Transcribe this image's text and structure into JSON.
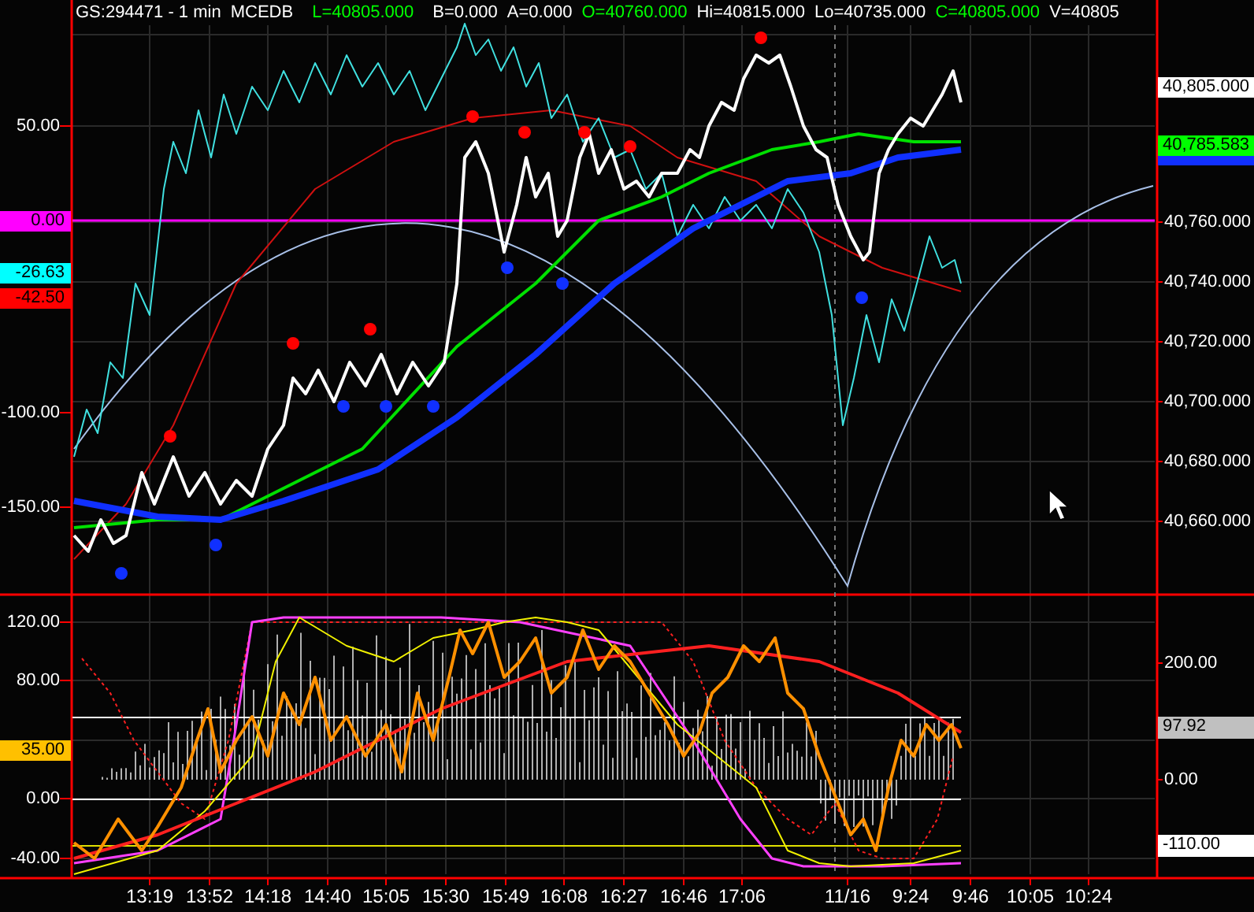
{
  "header": [
    {
      "text": "GS:294471 - 1 min",
      "color": "#ffffff"
    },
    {
      "text": "MCEDB",
      "color": "#ffffff"
    },
    {
      "text": "L=40805.000",
      "color": "#00ff00"
    },
    {
      "text": "B=0.000",
      "color": "#ffffff"
    },
    {
      "text": "A=0.000",
      "color": "#ffffff"
    },
    {
      "text": "O=40760.000",
      "color": "#00ff00"
    },
    {
      "text": "Hi=40815.000",
      "color": "#ffffff"
    },
    {
      "text": "Lo=40735.000",
      "color": "#ffffff"
    },
    {
      "text": "C=40805.000",
      "color": "#00ff00"
    },
    {
      "text": "V=40805",
      "color": "#ffffff"
    }
  ],
  "price_panel": {
    "left_ticks": [
      "50.00",
      "-100.00",
      "-150.00"
    ],
    "left_markers": [
      {
        "text": "0.00",
        "color": "#ff00ff"
      },
      {
        "text": "-26.63",
        "color": "#00ffff"
      },
      {
        "text": "-42.50",
        "color": "#ff0000"
      }
    ],
    "right_ticks": [
      "40,760.000",
      "40,740.000",
      "40,720.000",
      "40,700.000",
      "40,680.000",
      "40,660.000"
    ],
    "right_markers": [
      {
        "text": "40,805.000",
        "color": "#ffffff"
      },
      {
        "text": "40,785.583",
        "color": "#00ff00"
      }
    ]
  },
  "indicator_panel": {
    "left_ticks": [
      "120.00",
      "80.00",
      "0.00",
      "-40.00"
    ],
    "left_markers": [
      {
        "text": "35.00",
        "color": "#ffc000"
      }
    ],
    "right_ticks": [
      "200.00",
      "0.00"
    ],
    "right_markers": [
      {
        "text": "97.92",
        "color": "#c0c0c0"
      },
      {
        "text": "-110.00",
        "color": "#ffffff"
      }
    ]
  },
  "time_axis": [
    "13:19",
    "13:52",
    "14:18",
    "14:40",
    "15:05",
    "15:30",
    "15:49",
    "16:08",
    "16:27",
    "16:46",
    "17:06",
    "11/16",
    "9:24",
    "9:46",
    "10:05",
    "10:24"
  ]
}
